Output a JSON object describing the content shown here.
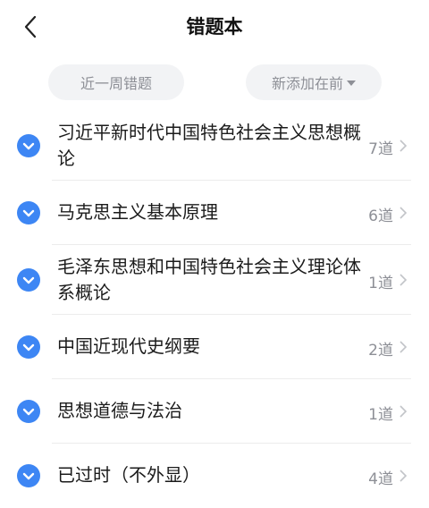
{
  "header": {
    "title": "错题本"
  },
  "filters": {
    "range_label": "近一周错题",
    "sort_label": "新添加在前"
  },
  "subjects": [
    {
      "label": "习近平新时代中国特色社会主义思想概论",
      "count": "7道"
    },
    {
      "label": "马克思主义基本原理",
      "count": "6道"
    },
    {
      "label": "毛泽东思想和中国特色社会主义理论体系概论",
      "count": "1道"
    },
    {
      "label": "中国近现代史纲要",
      "count": "2道"
    },
    {
      "label": "思想道德与法治",
      "count": "1道"
    },
    {
      "label": "已过时（不外显）",
      "count": "4道"
    }
  ],
  "colors": {
    "accent": "#3d86f4",
    "muted": "#8d8f96",
    "pill_bg": "#f2f3f5"
  }
}
